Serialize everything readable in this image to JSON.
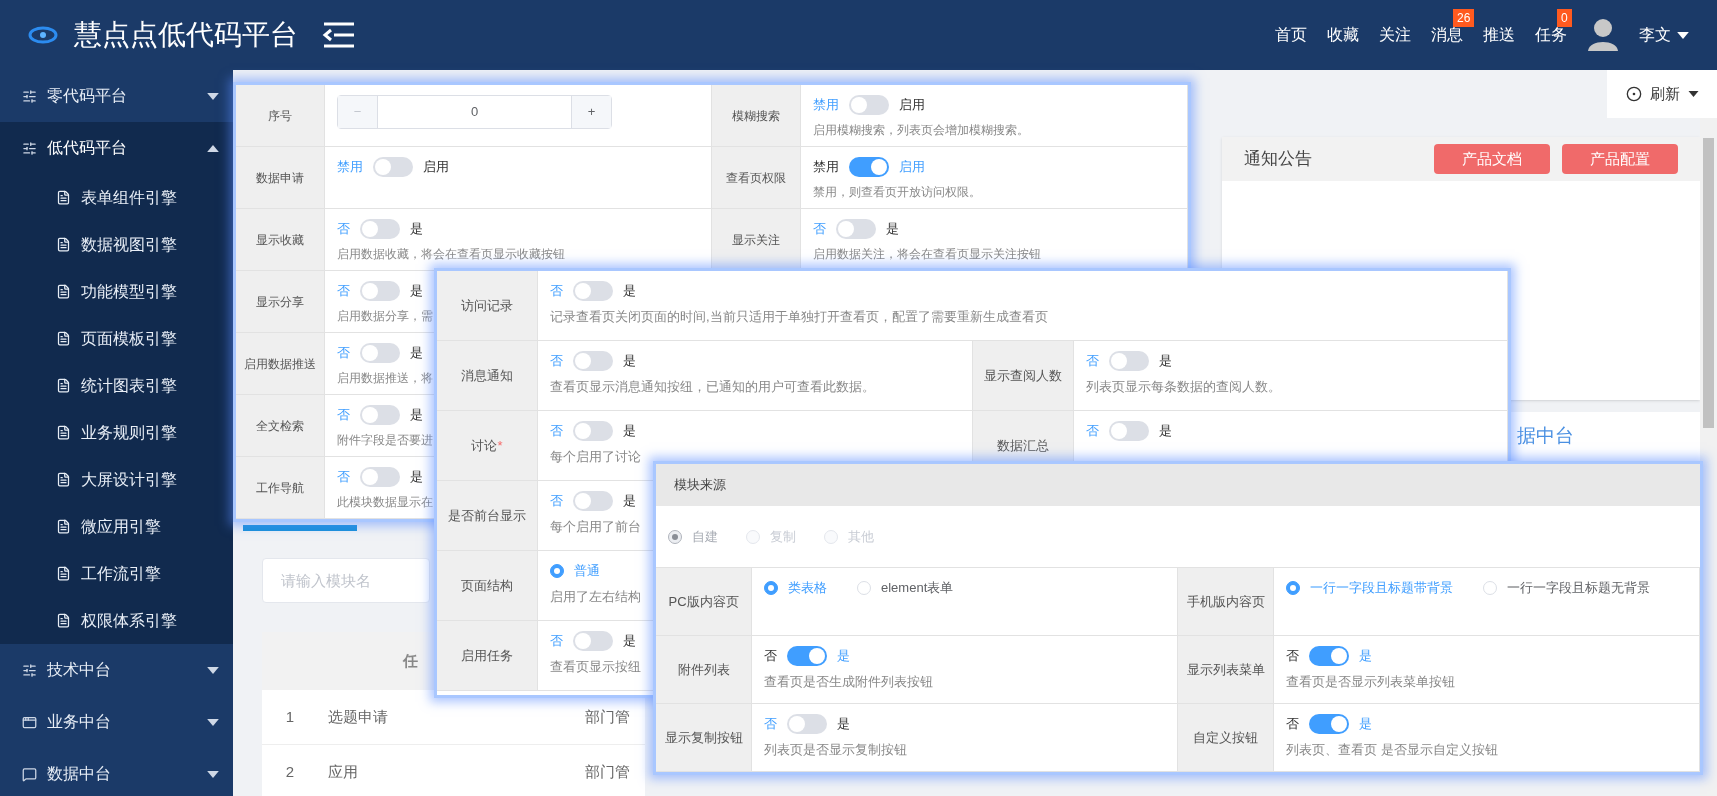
{
  "header": {
    "title": "慧点点低代码平台",
    "nav": [
      {
        "label": "首页"
      },
      {
        "label": "收藏"
      },
      {
        "label": "关注"
      },
      {
        "label": "消息",
        "badge": "26"
      },
      {
        "label": "推送"
      },
      {
        "label": "任务",
        "badge": "0"
      }
    ],
    "user": "李文"
  },
  "sidebar": [
    {
      "label": "零代码平台",
      "expanded": false
    },
    {
      "label": "低代码平台",
      "expanded": true,
      "children": [
        {
          "label": "表单组件引擎"
        },
        {
          "label": "数据视图引擎"
        },
        {
          "label": "功能模型引擎"
        },
        {
          "label": "页面模板引擎"
        },
        {
          "label": "统计图表引擎"
        },
        {
          "label": "业务规则引擎"
        },
        {
          "label": "大屏设计引擎"
        },
        {
          "label": "微应用引擎"
        },
        {
          "label": "工作流引擎"
        },
        {
          "label": "权限体系引擎"
        }
      ]
    },
    {
      "label": "技术中台",
      "expanded": false
    },
    {
      "label": "业务中台",
      "expanded": false
    },
    {
      "label": "数据中台",
      "expanded": false
    }
  ],
  "toolbar": {
    "refresh": "刷新"
  },
  "notice": {
    "title": "通知公告",
    "buttons": [
      "产品文档",
      "产品配置"
    ]
  },
  "second_card": {
    "title": "据中台"
  },
  "search": {
    "placeholder": "请输入模块名"
  },
  "table": {
    "header": "任",
    "rows": [
      {
        "index": "1",
        "name": "选题申请",
        "column_3": "部门管"
      },
      {
        "index": "2",
        "name": "应用",
        "column_3": "部门管"
      }
    ]
  },
  "panels": [
    {
      "rows": [
        {
          "cells": [
            {
              "label": "序号",
              "control": {
                "kind": "stepper",
                "minus": "−",
                "value": "0",
                "plus": "+"
              }
            },
            {
              "label": "模糊搜索",
              "control": {
                "kind": "switch",
                "off_label": "禁用",
                "on_label": "启用",
                "on": false
              },
              "description": "启用模糊搜索，列表页会增加模糊搜索。"
            }
          ]
        },
        {
          "cells": [
            {
              "label": "数据申请",
              "control": {
                "kind": "switch",
                "off_label": "禁用",
                "on_label": "启用",
                "on": false
              }
            },
            {
              "label": "查看页权限",
              "control": {
                "kind": "switch",
                "off_label": "禁用",
                "on_label": "启用",
                "on": true
              },
              "description": "禁用，则查看页开放访问权限。"
            }
          ]
        },
        {
          "cells": [
            {
              "label": "显示收藏",
              "control": {
                "kind": "switch",
                "off_label": "否",
                "on_label": "是",
                "on": false
              },
              "description": "启用数据收藏，将会在查看页显示收藏按钮"
            },
            {
              "label": "显示关注",
              "control": {
                "kind": "switch",
                "off_label": "否",
                "on_label": "是",
                "on": false
              },
              "description": "启用数据关注，将会在查看页显示关注按钮"
            }
          ]
        },
        {
          "cells": [
            {
              "label": "显示分享",
              "control": {
                "kind": "switch",
                "off_label": "否",
                "on_label": "是",
                "on": false
              },
              "description": "启用数据分享，需"
            }
          ]
        },
        {
          "cells": [
            {
              "label": "启用数据推送",
              "control": {
                "kind": "switch",
                "off_label": "否",
                "on_label": "是",
                "on": false
              },
              "description": "启用数据推送，将"
            }
          ]
        },
        {
          "cells": [
            {
              "label": "全文检索",
              "control": {
                "kind": "switch",
                "off_label": "否",
                "on_label": "是",
                "on": false
              },
              "description": "附件字段是否要进"
            }
          ]
        },
        {
          "cells": [
            {
              "label": "工作导航",
              "control": {
                "kind": "switch",
                "off_label": "否",
                "on_label": "是",
                "on": false
              },
              "description": "此模块数据显示在"
            }
          ]
        }
      ]
    },
    {
      "rows": [
        {
          "wide": true,
          "cells": [
            {
              "label": "访问记录",
              "control": {
                "kind": "switch",
                "off_label": "否",
                "on_label": "是",
                "on": false
              },
              "description": "记录查看页关闭页面的时间,当前只适用于单独打开查看页，配置了需要重新生成查看页"
            }
          ]
        },
        {
          "cells": [
            {
              "label": "消息通知",
              "control": {
                "kind": "switch",
                "off_label": "否",
                "on_label": "是",
                "on": false
              },
              "description": "查看页显示消息通知按纽，已通知的用户可查看此数据。"
            },
            {
              "label": "显示查阅人数",
              "control": {
                "kind": "switch",
                "off_label": "否",
                "on_label": "是",
                "on": false
              },
              "description": "列表页显示每条数据的查阅人数。"
            }
          ]
        },
        {
          "cells": [
            {
              "label": "讨论",
              "required": "*",
              "control": {
                "kind": "switch",
                "off_label": "否",
                "on_label": "是",
                "on": false
              },
              "description": "每个启用了讨论"
            },
            {
              "label": "数据汇总",
              "control": {
                "kind": "switch",
                "off_label": "否",
                "on_label": "是",
                "on": false
              }
            }
          ]
        },
        {
          "cells": [
            {
              "label": "是否前台显示",
              "control": {
                "kind": "switch",
                "off_label": "否",
                "on_label": "是",
                "on": false
              },
              "description": "每个启用了前台"
            }
          ]
        },
        {
          "cells": [
            {
              "label": "页面结构",
              "control": {
                "kind": "radio",
                "options": [
                  {
                    "label": "普通",
                    "selected": true
                  }
                ]
              },
              "description": "启用了左右结构"
            }
          ]
        },
        {
          "cells": [
            {
              "label": "启用任务",
              "control": {
                "kind": "switch",
                "off_label": "否",
                "on_label": "是",
                "on": false
              },
              "description": "查看页显示按纽"
            }
          ]
        }
      ]
    },
    {
      "title": "模块来源",
      "source": {
        "disabled": true,
        "options": [
          {
            "label": "自建",
            "selected": true
          },
          {
            "label": "复制",
            "selected": false
          },
          {
            "label": "其他",
            "selected": false
          }
        ]
      },
      "rows": [
        {
          "cells": [
            {
              "label": "PC版内容页",
              "control": {
                "kind": "radio",
                "options": [
                  {
                    "label": "类表格",
                    "selected": true
                  },
                  {
                    "label": "element表单",
                    "selected": false
                  }
                ]
              }
            },
            {
              "label": "手机版内容页",
              "control": {
                "kind": "radio",
                "options": [
                  {
                    "label": "一行一字段且标题带背景",
                    "selected": true
                  },
                  {
                    "label": "一行一字段且标题无背景",
                    "selected": false
                  }
                ]
              }
            }
          ]
        },
        {
          "cells": [
            {
              "label": "附件列表",
              "control": {
                "kind": "switch",
                "off_label": "否",
                "on_label": "是",
                "on": true
              },
              "description": "查看页是否生成附件列表按钮"
            },
            {
              "label": "显示列表菜单",
              "control": {
                "kind": "switch",
                "off_label": "否",
                "on_label": "是",
                "on": true
              },
              "description": "查看页是否显示列表菜单按钮"
            }
          ]
        },
        {
          "cells": [
            {
              "label": "显示复制按钮",
              "control": {
                "kind": "switch",
                "off_label": "否",
                "on_label": "是",
                "on": false
              },
              "description": "列表页是否显示复制按钮"
            },
            {
              "label": "自定义按钮",
              "control": {
                "kind": "switch",
                "off_label": "否",
                "on_label": "是",
                "on": true
              },
              "description": "列表页、查看页 是否显示自定义按钮"
            }
          ]
        }
      ]
    }
  ]
}
